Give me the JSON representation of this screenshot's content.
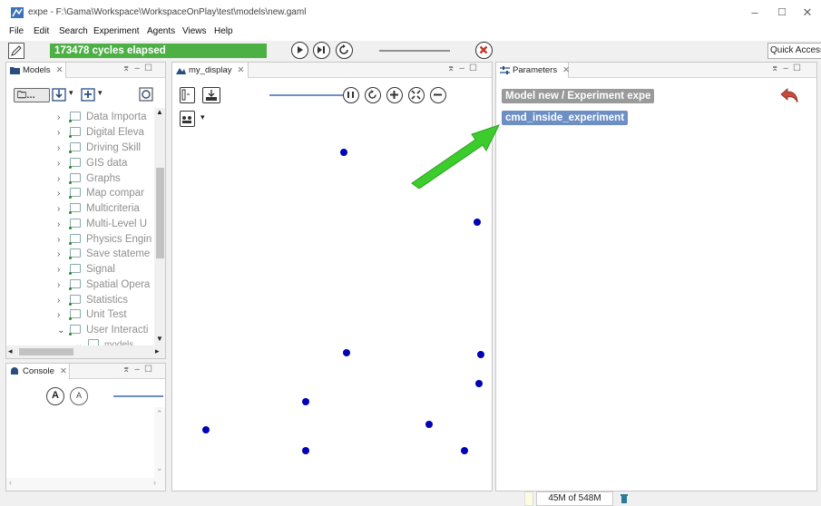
{
  "window": {
    "title": "expe - F:\\Gama\\Workspace\\WorkspaceOnPlay\\test\\models\\new.gaml",
    "minimize": "–",
    "maximize": "☐",
    "close": "✕"
  },
  "menu": [
    "File",
    "Edit",
    "Search",
    "Experiment",
    "Agents",
    "Views",
    "Help"
  ],
  "toolbar": {
    "cycles": "173478 cycles elapsed",
    "quick_access": "Quick Access"
  },
  "models_panel": {
    "tab": "Models",
    "items": [
      {
        "label": "Data Importa",
        "chev": "›"
      },
      {
        "label": "Digital Eleva",
        "chev": "›"
      },
      {
        "label": "Driving Skill",
        "chev": "›"
      },
      {
        "label": "GIS data",
        "chev": "›"
      },
      {
        "label": "Graphs",
        "chev": "›"
      },
      {
        "label": "Map compar",
        "chev": "›"
      },
      {
        "label": "Multicriteria",
        "chev": "›"
      },
      {
        "label": "Multi-Level U",
        "chev": "›"
      },
      {
        "label": "Physics Engin",
        "chev": "›"
      },
      {
        "label": "Save stateme",
        "chev": "›"
      },
      {
        "label": "Signal",
        "chev": "›"
      },
      {
        "label": "Spatial Opera",
        "chev": "›"
      },
      {
        "label": "Statistics",
        "chev": "›"
      },
      {
        "label": "Unit Test",
        "chev": "›"
      },
      {
        "label": "User Interacti",
        "chev": "⌄"
      },
      {
        "label": "models",
        "chev": "⌄"
      }
    ]
  },
  "console_panel": {
    "tab": "Console"
  },
  "display_panel": {
    "tab": "my_display"
  },
  "parameters_panel": {
    "tab": "Parameters",
    "header": "Model new / Experiment expe",
    "param": "cmd_inside_experiment"
  },
  "status": {
    "memory": "45M of 548M"
  },
  "colors": {
    "cycles_bg": "#4cb045",
    "param_header_bg": "#9a9a9a",
    "param_bg": "#6e8fc4",
    "agent": "#0000b4",
    "arrow": "#3ccc2c"
  }
}
